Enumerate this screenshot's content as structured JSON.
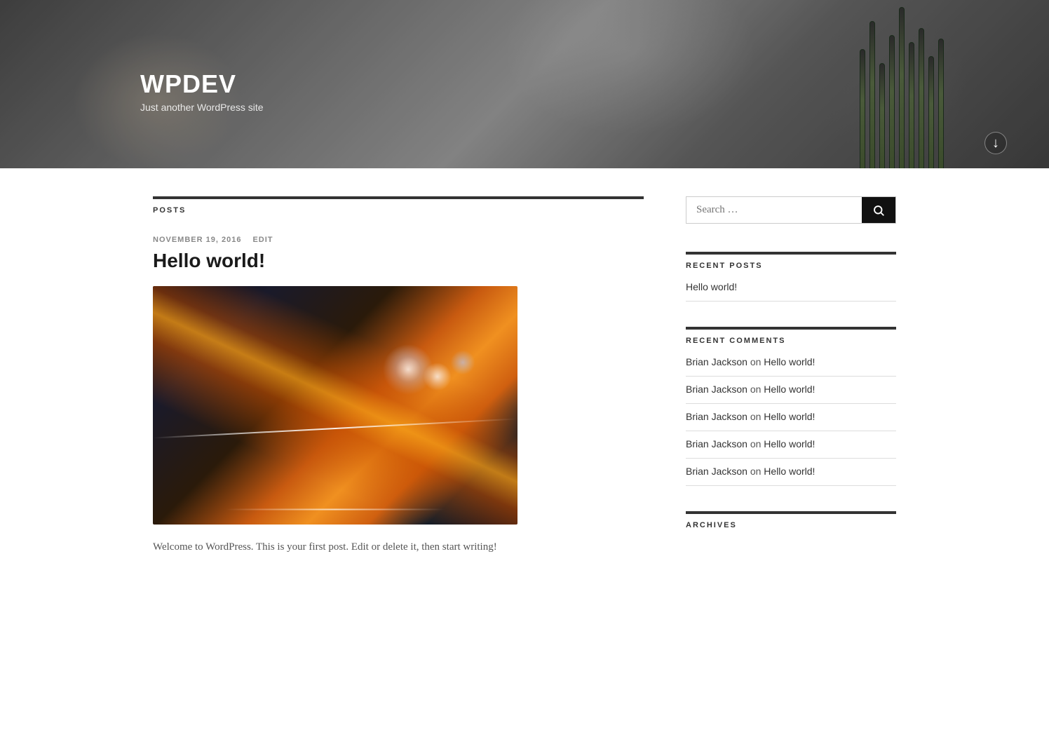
{
  "site": {
    "title": "WPDEV",
    "tagline": "Just another WordPress site"
  },
  "header": {
    "scroll_down_icon": "↓"
  },
  "posts_section": {
    "label": "POSTS"
  },
  "post": {
    "date": "NOVEMBER 19, 2016",
    "edit_label": "EDIT",
    "title": "Hello world!",
    "excerpt": "Welcome to WordPress. This is your first post. Edit or delete it, then start writing!"
  },
  "sidebar": {
    "search": {
      "placeholder": "Search …",
      "button_label": "Search",
      "button_icon": "🔍"
    },
    "recent_posts": {
      "title": "RECENT POSTS",
      "items": [
        {
          "label": "Hello world!"
        }
      ]
    },
    "recent_comments": {
      "title": "RECENT COMMENTS",
      "items": [
        {
          "commenter": "Brian Jackson",
          "on": "on",
          "post": "Hello world!"
        },
        {
          "commenter": "Brian Jackson",
          "on": "on",
          "post": "Hello world!"
        },
        {
          "commenter": "Brian Jackson",
          "on": "on",
          "post": "Hello world!"
        },
        {
          "commenter": "Brian Jackson",
          "on": "on",
          "post": "Hello world!"
        },
        {
          "commenter": "Brian Jackson",
          "on": "on",
          "post": "Hello world!"
        }
      ]
    },
    "archives": {
      "title": "ARCHIVES"
    }
  }
}
